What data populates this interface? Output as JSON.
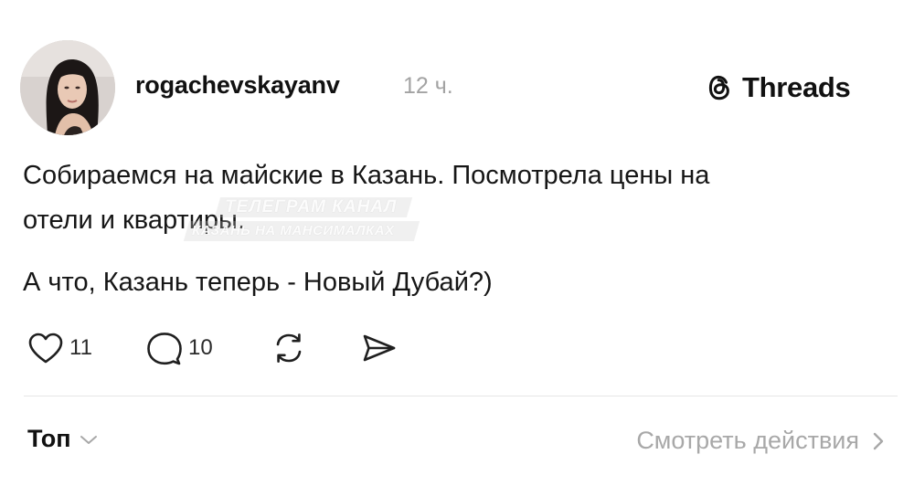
{
  "post": {
    "username": "rogachevskayanv",
    "time": "12 ч.",
    "brand": "Threads",
    "text_line1": "Собираемся на майские в Казань. Посмотрела цены на",
    "text_line2": "отели и квартиры.",
    "text_line3": "А что, Казань теперь - Новый Дубай?)"
  },
  "watermark": {
    "line1": "ТЕЛЕГРАМ КАНАЛ",
    "line2": "КАЗАНЬ НА МАНСИМАЛКАХ"
  },
  "actions": {
    "likes_count": "11",
    "replies_count": "10"
  },
  "footer": {
    "sort_label": "Топ",
    "view_activity_label": "Смотреть действия"
  },
  "icons": {
    "brand": "threads-logo-icon",
    "like": "heart-icon",
    "reply": "comment-icon",
    "repost": "repost-icon",
    "share": "send-icon",
    "sort": "chevron-down-icon",
    "view_activity": "chevron-right-icon"
  }
}
